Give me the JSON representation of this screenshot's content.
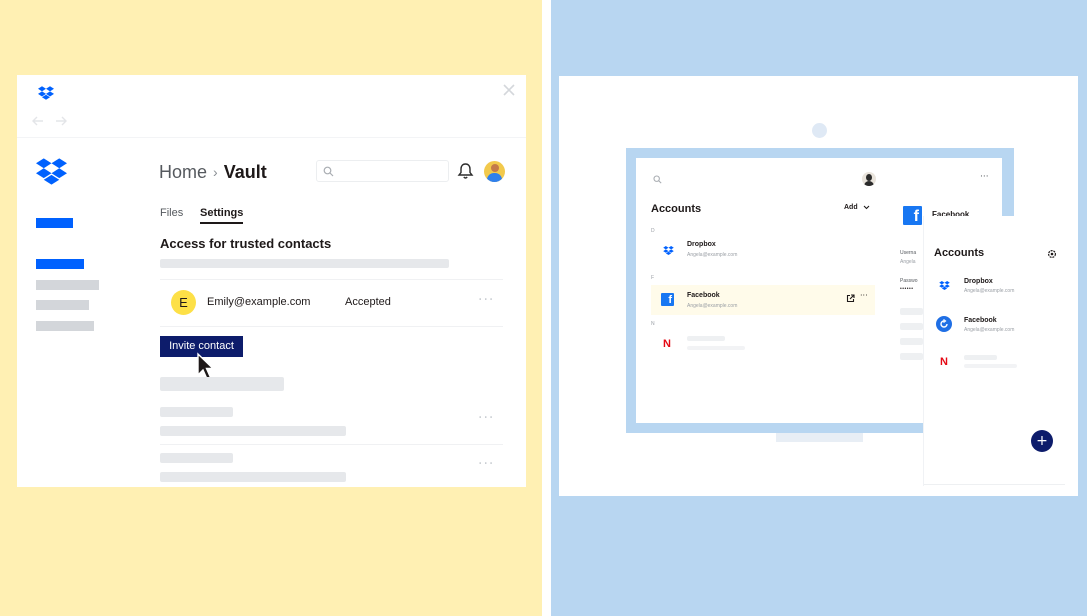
{
  "colors": {
    "yellow_bg": "#fff0b3",
    "blue_bg": "#b8d6f1",
    "dropbox_blue": "#0061fe",
    "navy": "#0d1c6b",
    "facebook_blue": "#1877f2",
    "netflix_red": "#e50914"
  },
  "left": {
    "breadcrumb": {
      "home": "Home",
      "separator": "›",
      "current": "Vault"
    },
    "tabs": [
      {
        "label": "Files",
        "active": false
      },
      {
        "label": "Settings",
        "active": true
      }
    ],
    "section_title": "Access for trusted contacts",
    "contact": {
      "initial": "E",
      "email": "Emily@example.com",
      "status": "Accepted"
    },
    "invite_button": "Invite contact",
    "icons": [
      "dropbox-icon",
      "close-icon",
      "back-arrow-icon",
      "forward-arrow-icon",
      "search-icon",
      "bell-icon",
      "avatar",
      "cursor-icon"
    ]
  },
  "right": {
    "main": {
      "title": "Accounts",
      "add_button": "Add",
      "sections": [
        {
          "letter": "D",
          "items": [
            {
              "name": "Dropbox",
              "email": "Angela@example.com"
            }
          ]
        },
        {
          "letter": "F",
          "items": [
            {
              "name": "Facebook",
              "email": "Angela@example.com"
            }
          ]
        },
        {
          "letter": "N",
          "items": []
        }
      ]
    },
    "detail": {
      "title": "Facebook",
      "username_label": "Userna",
      "username_value": "Angela",
      "password_label": "Passwo",
      "password_dots": "••••••"
    },
    "mobile": {
      "title": "Accounts",
      "items": [
        {
          "name": "Dropbox",
          "email": "Angela@example.com"
        },
        {
          "name": "Facebook",
          "email": "Angela@example.com"
        }
      ],
      "fab": "+"
    }
  }
}
